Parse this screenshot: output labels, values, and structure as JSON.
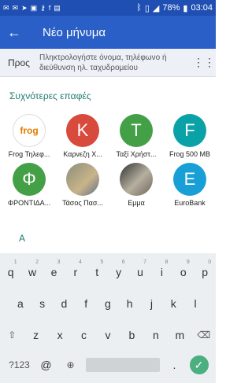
{
  "status": {
    "battery": "78%",
    "time": "03:04"
  },
  "appbar": {
    "title": "Νέο μήνυμα"
  },
  "compose": {
    "to_label": "Προς",
    "placeholder": "Πληκτρολογήστε όνομα, τηλέφωνο ή διεύθυνση ηλ. ταχυδρομείου"
  },
  "section": {
    "recent": "Συχνότερες επαφές",
    "alpha": "Α"
  },
  "contacts": [
    {
      "name": "Frog Τηλεφ...",
      "initial": "frog",
      "color": "#ffffff"
    },
    {
      "name": "Καρνεζη Χ...",
      "initial": "Κ",
      "color": "#d84a3b"
    },
    {
      "name": "Ταξί Χρήστ...",
      "initial": "Τ",
      "color": "#43a047"
    },
    {
      "name": "Frog 500 MB",
      "initial": "F",
      "color": "#0aa1a7"
    },
    {
      "name": "ΦΡΟΝΤΙΔΑ...",
      "initial": "Φ",
      "color": "#43a047"
    },
    {
      "name": "Τάσος Πασ...",
      "initial": "",
      "color": "#8a8d7a"
    },
    {
      "name": "Εμμα",
      "initial": "",
      "color": "#5b5b5b"
    },
    {
      "name": "EuroBank",
      "initial": "E",
      "color": "#18a0d6"
    }
  ],
  "keyboard": {
    "row1": [
      "q",
      "w",
      "e",
      "r",
      "t",
      "y",
      "u",
      "i",
      "o",
      "p"
    ],
    "row1_nums": [
      "1",
      "2",
      "3",
      "4",
      "5",
      "6",
      "7",
      "8",
      "9",
      "0"
    ],
    "row2": [
      "a",
      "s",
      "d",
      "f",
      "g",
      "h",
      "j",
      "k",
      "l"
    ],
    "row3": [
      "z",
      "x",
      "c",
      "v",
      "b",
      "n",
      "m"
    ],
    "symbols": "?123",
    "at": "@"
  }
}
